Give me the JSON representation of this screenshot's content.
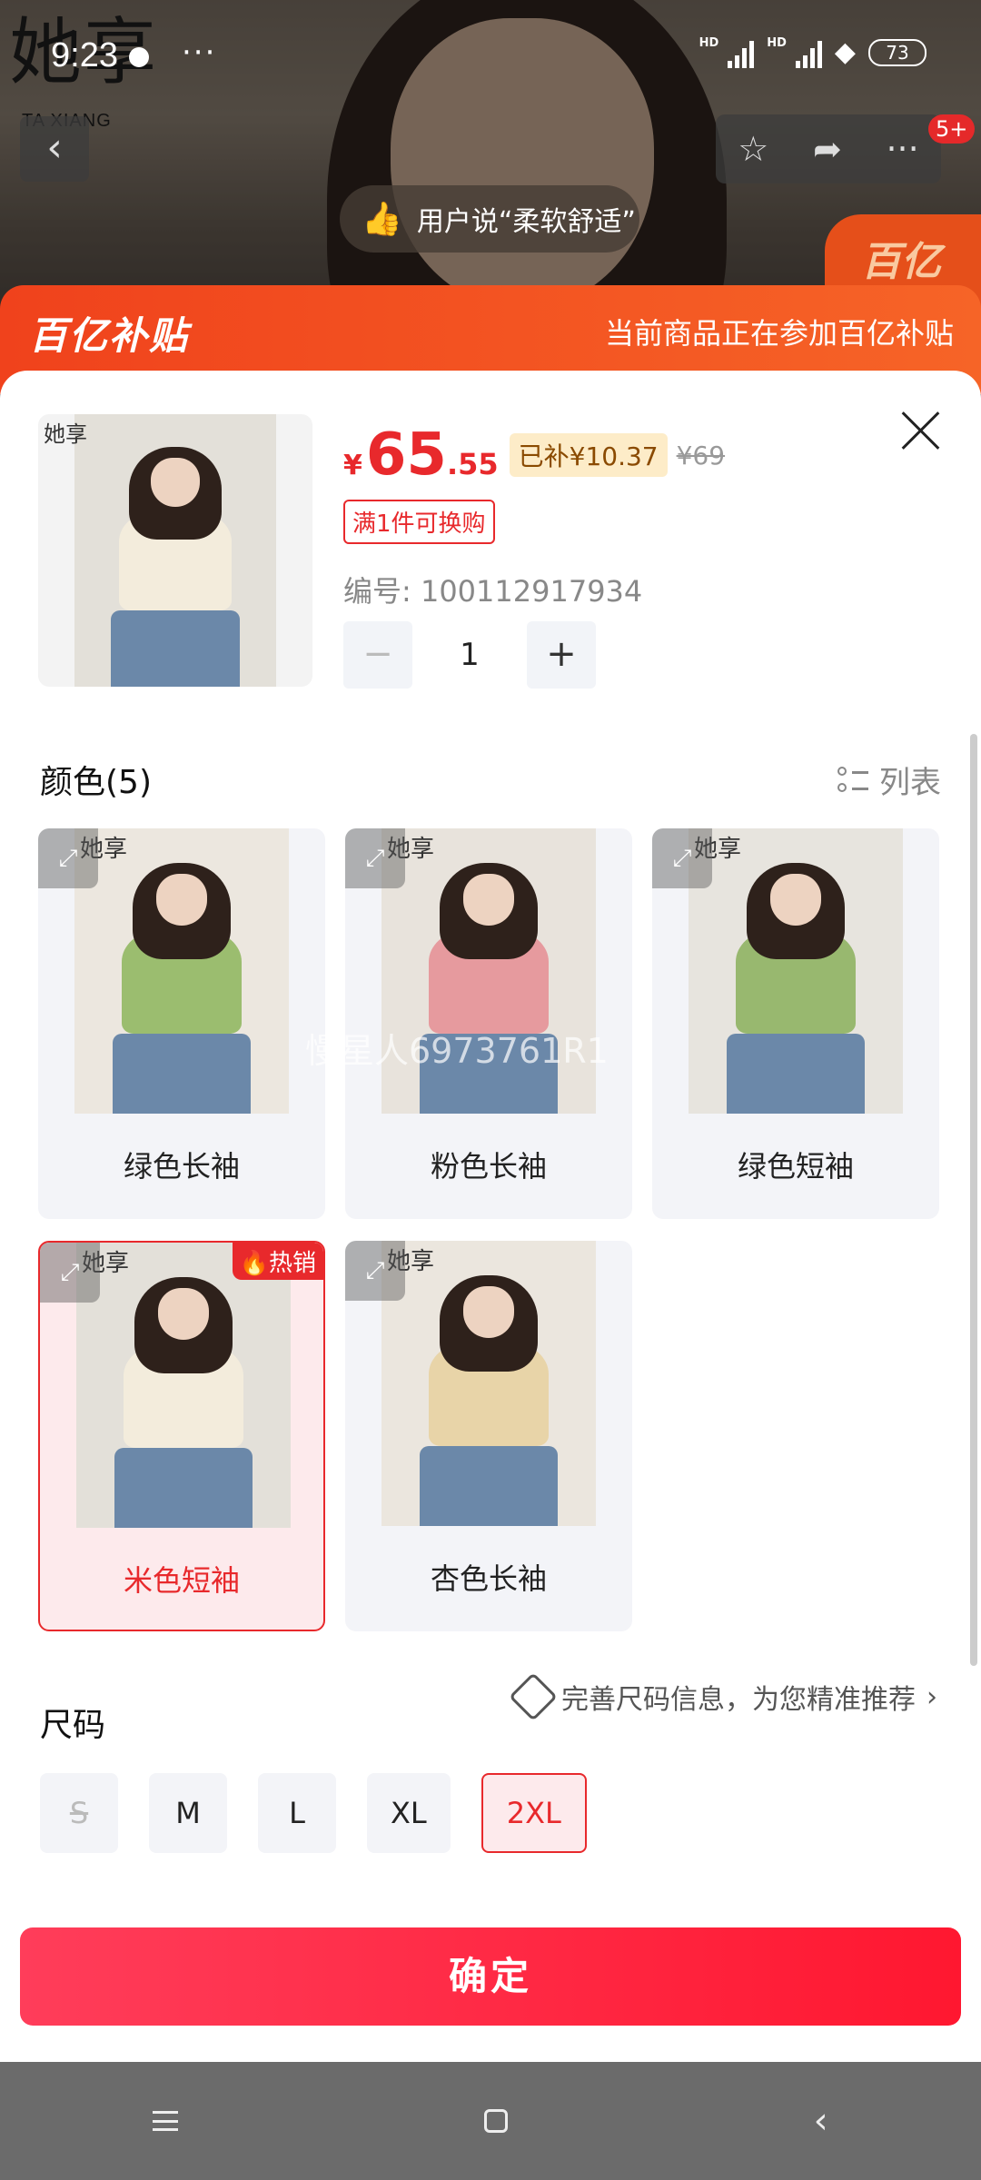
{
  "status_bar": {
    "time": "9:23",
    "battery": "73",
    "more": "···"
  },
  "brand": {
    "logo_text": "她享",
    "logo_sub": "TA XIANG"
  },
  "product_page": {
    "review_pill": "用户说“柔软舒适”",
    "message_badge": "5+",
    "corner_tag": "百亿"
  },
  "subsidy_banner": {
    "logo": "百亿补贴",
    "text": "当前商品正在参加百亿补贴",
    "color": "#f0421c"
  },
  "sheet": {
    "price_symbol": "¥",
    "price_int": "65",
    "price_dec": ".55",
    "subsidy_amount": "已补¥10.37",
    "original_price": "¥69",
    "promo_tag": "满1件可换购",
    "sku_code": "编号: 100112917934",
    "quantity": "1",
    "qty_minus": "−",
    "qty_plus": "+",
    "thumb_logo": "她享",
    "accent_color": "#e8292c"
  },
  "color_section": {
    "title": "颜色(5)",
    "list_toggle": "列表",
    "hot_badge": "🔥热销",
    "watermark": "慢星人6973761R1",
    "photo_logo": "她享",
    "options": [
      {
        "label": "绿色长袖",
        "top_color": "#9bbd6f",
        "bg": "#ece7df",
        "selected": false
      },
      {
        "label": "粉色长袖",
        "top_color": "#e69a9e",
        "bg": "#e8e3dc",
        "selected": false
      },
      {
        "label": "绿色短袖",
        "top_color": "#98b86f",
        "bg": "#e7e4de",
        "selected": false
      },
      {
        "label": "米色短袖",
        "top_color": "#f3ecdc",
        "bg": "#e3e0d9",
        "selected": true
      },
      {
        "label": "杏色长袖",
        "top_color": "#e8d4a8",
        "bg": "#ebe6de",
        "selected": false
      }
    ]
  },
  "size_section": {
    "title": "尺码",
    "hint": "完善尺码信息，为您精准推荐",
    "hint_arrow": "›",
    "options": [
      {
        "label": "S",
        "state": "disabled"
      },
      {
        "label": "M",
        "state": "normal"
      },
      {
        "label": "L",
        "state": "normal"
      },
      {
        "label": "XL",
        "state": "normal"
      },
      {
        "label": "2XL",
        "state": "selected"
      }
    ]
  },
  "confirm": {
    "label": "确定"
  },
  "icons": {
    "back": "back-arrow-icon",
    "star": "star-icon",
    "share": "share-icon",
    "more": "more-icon",
    "close": "close-icon",
    "list": "list-icon",
    "expand": "expand-icon",
    "ruler": "ruler-icon",
    "thumb": "thumbs-up-icon"
  }
}
